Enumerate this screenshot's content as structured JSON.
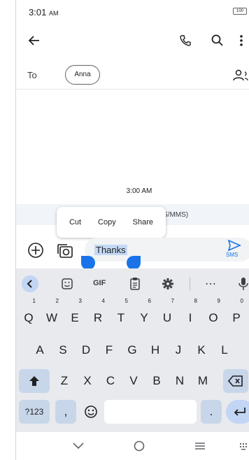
{
  "status_bar": {
    "time": "3:01",
    "ampm": "AM",
    "battery": "100"
  },
  "recipients": {
    "to_label": "To",
    "chip": "Anna"
  },
  "conversation": {
    "timestamp": "3:00 AM",
    "info_text": "S/MMS)"
  },
  "text_menu": {
    "cut": "Cut",
    "copy": "Copy",
    "share": "Share"
  },
  "compose": {
    "message": "Thanks",
    "send_label": "SMS"
  },
  "keyboard": {
    "toolbar": {
      "gif": "GIF",
      "more": "⋯"
    },
    "row1": [
      {
        "k": "Q",
        "h": "1"
      },
      {
        "k": "W",
        "h": "2"
      },
      {
        "k": "E",
        "h": "3"
      },
      {
        "k": "R",
        "h": "4"
      },
      {
        "k": "T",
        "h": "5"
      },
      {
        "k": "Y",
        "h": "6"
      },
      {
        "k": "U",
        "h": "7"
      },
      {
        "k": "I",
        "h": "8"
      },
      {
        "k": "O",
        "h": "9"
      },
      {
        "k": "P",
        "h": "0"
      }
    ],
    "row2": [
      "A",
      "S",
      "D",
      "F",
      "G",
      "H",
      "J",
      "K",
      "L"
    ],
    "row3": [
      "Z",
      "X",
      "C",
      "V",
      "B",
      "N",
      "M"
    ],
    "symbols_key": "?123",
    "comma": ",",
    "period": "."
  },
  "colors": {
    "accent": "#1a73e8",
    "selection": "#c5d9f5",
    "keyboard_bg": "#e8eaed"
  },
  "icons": [
    "back-arrow-icon",
    "phone-icon",
    "search-icon",
    "more-vert-icon",
    "add-person-icon",
    "add-circle-icon",
    "camera-icon",
    "send-icon",
    "emoji-sticker-icon",
    "clipboard-icon",
    "settings-icon",
    "mic-icon",
    "shift-icon",
    "backspace-icon",
    "emoji-icon",
    "enter-icon",
    "nav-back-icon",
    "nav-home-icon",
    "nav-recents-icon",
    "keyboard-switch-icon"
  ]
}
